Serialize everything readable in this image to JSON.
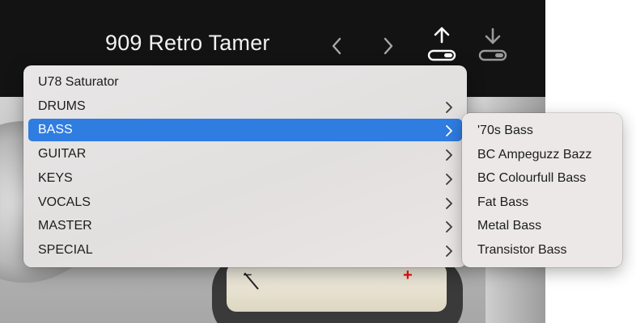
{
  "header": {
    "preset_title": "909 Retro Tamer",
    "prev_icon": "chevron-left-icon",
    "next_icon": "chevron-right-icon",
    "save_icon": "upload-arrow-icon",
    "load_icon": "download-arrow-icon"
  },
  "meter": {
    "minus": "−",
    "plus": "+"
  },
  "menu": {
    "items": [
      {
        "label": "U78 Saturator",
        "has_submenu": false
      },
      {
        "label": "DRUMS",
        "has_submenu": true
      },
      {
        "label": "BASS",
        "has_submenu": true,
        "selected": true
      },
      {
        "label": "GUITAR",
        "has_submenu": true
      },
      {
        "label": "KEYS",
        "has_submenu": true
      },
      {
        "label": "VOCALS",
        "has_submenu": true
      },
      {
        "label": "MASTER",
        "has_submenu": true
      },
      {
        "label": "SPECIAL",
        "has_submenu": true
      }
    ]
  },
  "submenu": {
    "items": [
      {
        "label": "'70s Bass"
      },
      {
        "label": "BC Ampeguzz Bazz"
      },
      {
        "label": "BC Colourfull Bass"
      },
      {
        "label": "Fat Bass"
      },
      {
        "label": "Metal Bass"
      },
      {
        "label": "Transistor Bass"
      }
    ]
  },
  "colors": {
    "selection": "#2f7de1",
    "header_bg": "#131313",
    "meter_plus": "#ee1111"
  }
}
